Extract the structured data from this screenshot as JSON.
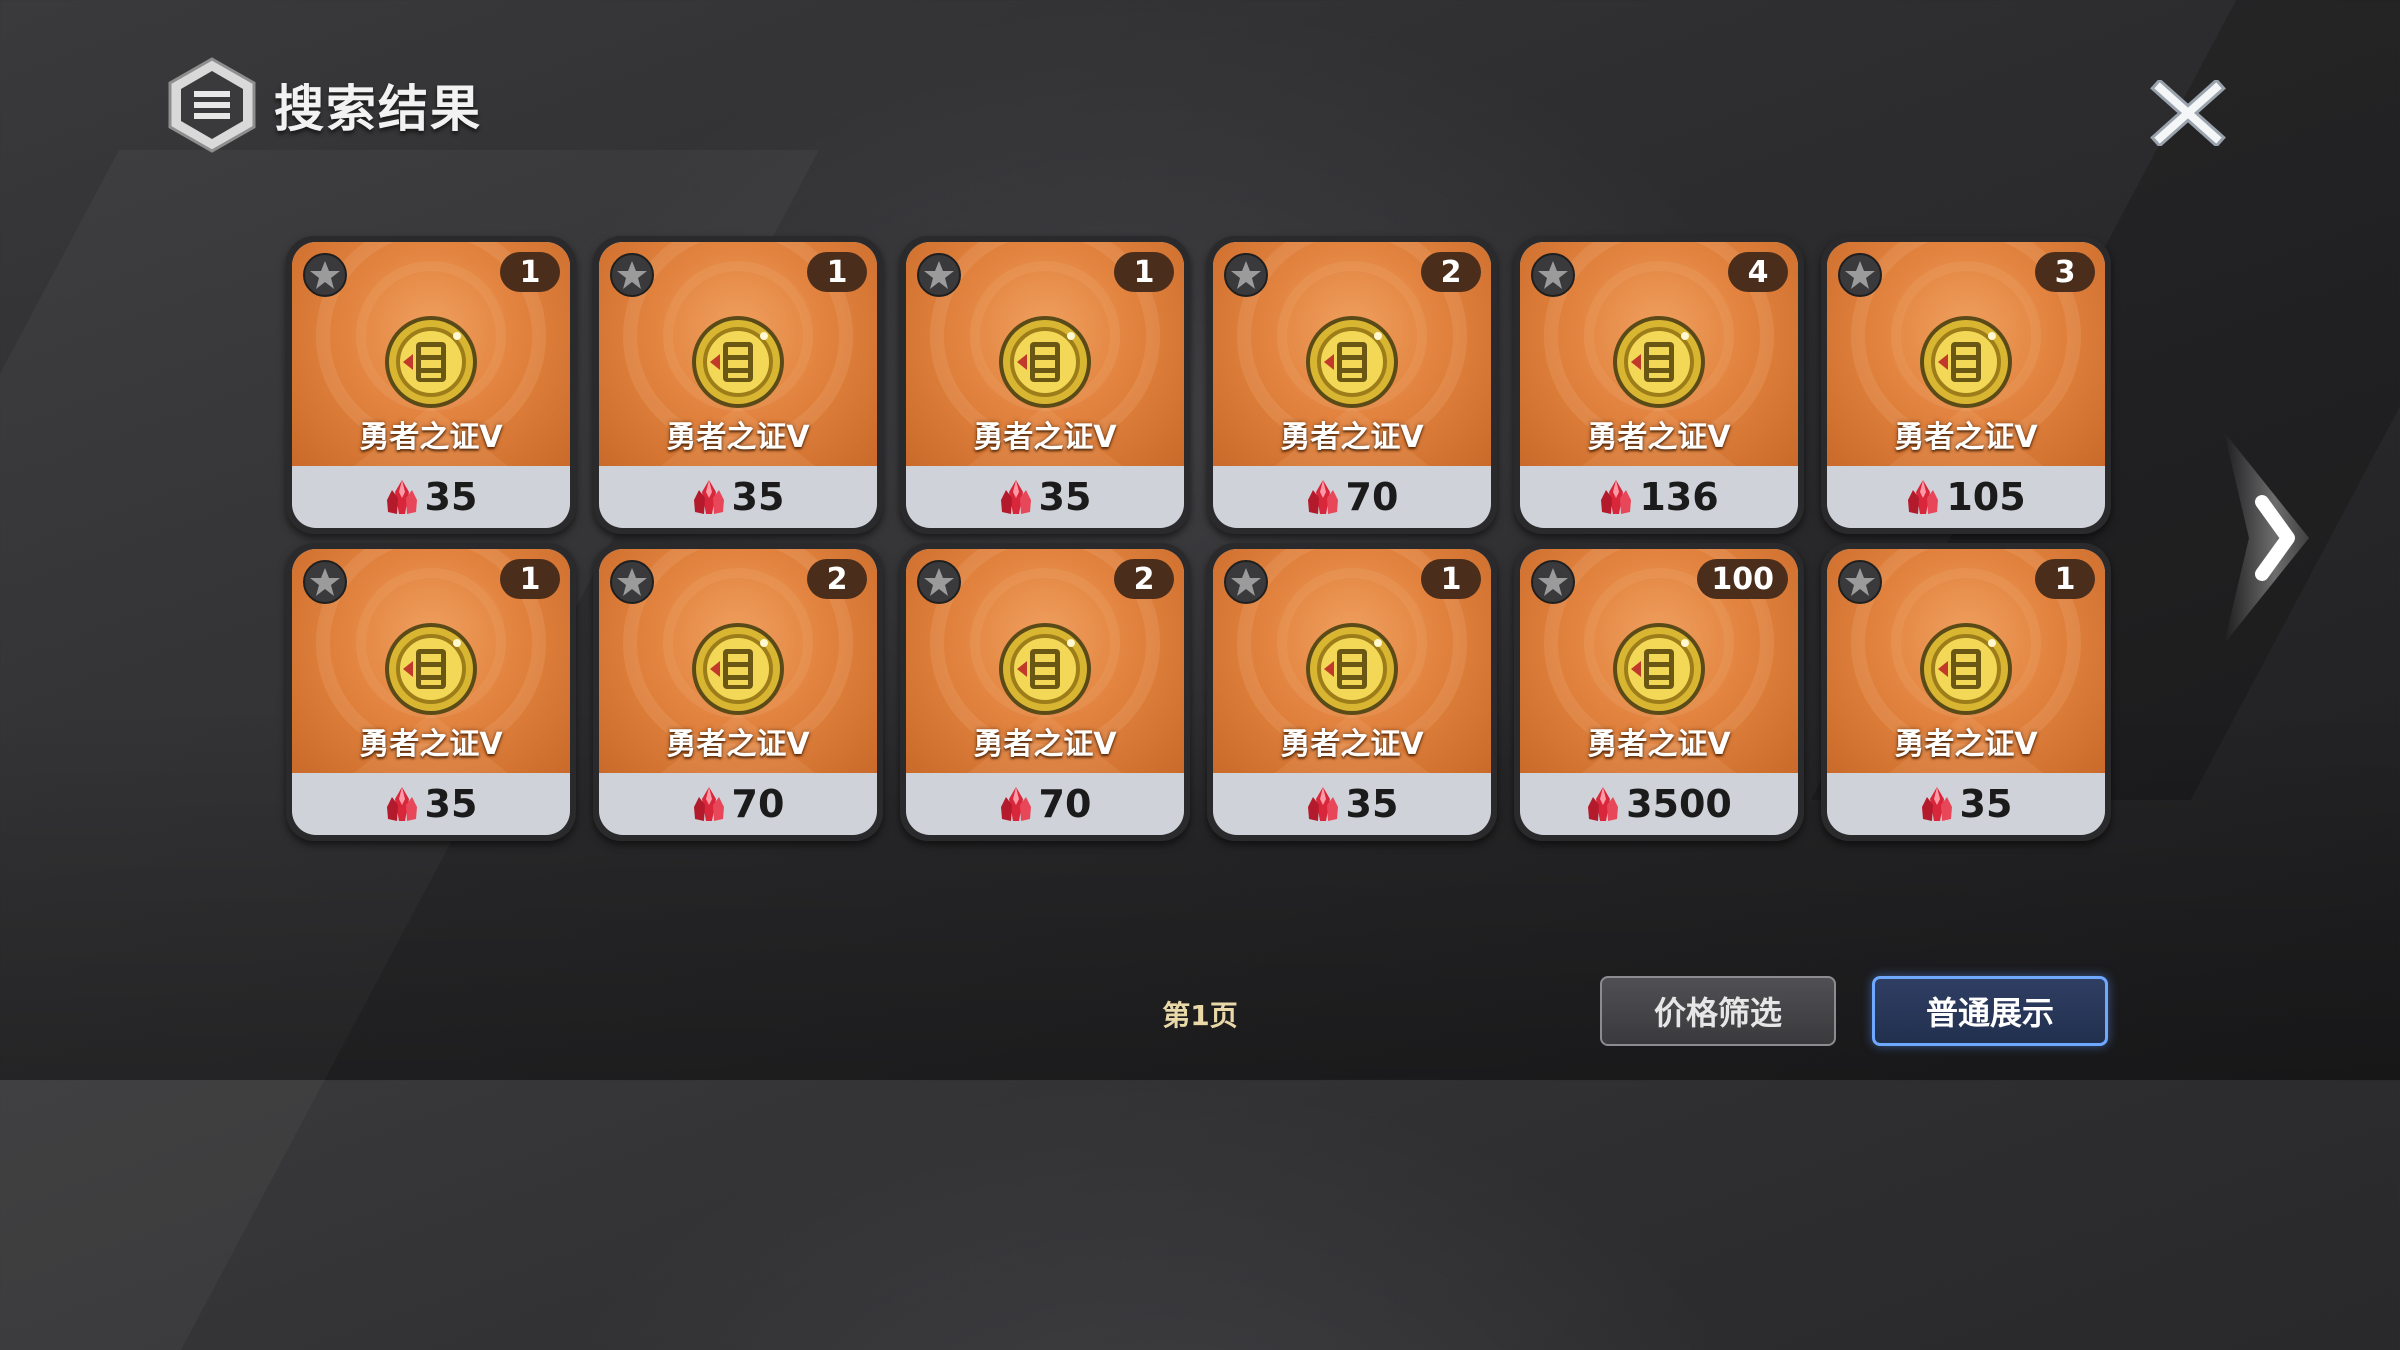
{
  "header": {
    "title": "搜索结果",
    "logo_icon": "menu-hexagon-icon",
    "close_icon": "close-icon"
  },
  "colors": {
    "card_orange": "#e2833f",
    "price_bar": "#cfd3d9",
    "qty_badge": "#4a2d1a",
    "accent_blue": "#6ea8ff",
    "page_label": "#e9d9a8"
  },
  "items": [
    {
      "name": "勇者之证V",
      "quantity": "1",
      "price": "35"
    },
    {
      "name": "勇者之证V",
      "quantity": "1",
      "price": "35"
    },
    {
      "name": "勇者之证V",
      "quantity": "1",
      "price": "35"
    },
    {
      "name": "勇者之证V",
      "quantity": "2",
      "price": "70"
    },
    {
      "name": "勇者之证V",
      "quantity": "4",
      "price": "136"
    },
    {
      "name": "勇者之证V",
      "quantity": "3",
      "price": "105"
    },
    {
      "name": "勇者之证V",
      "quantity": "1",
      "price": "35"
    },
    {
      "name": "勇者之证V",
      "quantity": "2",
      "price": "70"
    },
    {
      "name": "勇者之证V",
      "quantity": "2",
      "price": "70"
    },
    {
      "name": "勇者之证V",
      "quantity": "1",
      "price": "35"
    },
    {
      "name": "勇者之证V",
      "quantity": "100",
      "price": "3500"
    },
    {
      "name": "勇者之证V",
      "quantity": "1",
      "price": "35"
    }
  ],
  "pagination": {
    "page_label": "第1页",
    "next_icon": "chevron-right-icon"
  },
  "buttons": {
    "price_filter": "价格筛选",
    "normal_display": "普通展示"
  }
}
